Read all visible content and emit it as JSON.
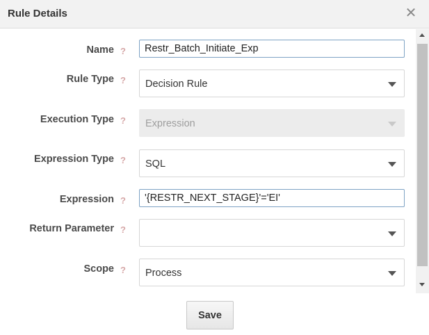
{
  "dialog": {
    "title": "Rule Details",
    "close_symbol": "✕"
  },
  "help_symbol": "?",
  "form": {
    "name": {
      "label": "Name",
      "value": "Restr_Batch_Initiate_Exp"
    },
    "rule_type": {
      "label": "Rule Type",
      "value": "Decision Rule"
    },
    "execution_type": {
      "label": "Execution Type",
      "value": "Expression",
      "disabled": true
    },
    "expression_type": {
      "label": "Expression Type",
      "value": "SQL"
    },
    "expression": {
      "label": "Expression",
      "value": "'{RESTR_NEXT_STAGE}'='EI'"
    },
    "return_parameter": {
      "label": "Return Parameter",
      "value": ""
    },
    "scope": {
      "label": "Scope",
      "value": "Process"
    }
  },
  "footer": {
    "save_label": "Save"
  },
  "icons": {
    "close": "close-icon",
    "help": "help-icon",
    "dropdown": "chevron-down-icon"
  },
  "colors": {
    "header_bg": "#f2f2f2",
    "input_border": "#7da2c4",
    "help_color": "#d6a8a8",
    "disabled_bg": "#ececec"
  }
}
